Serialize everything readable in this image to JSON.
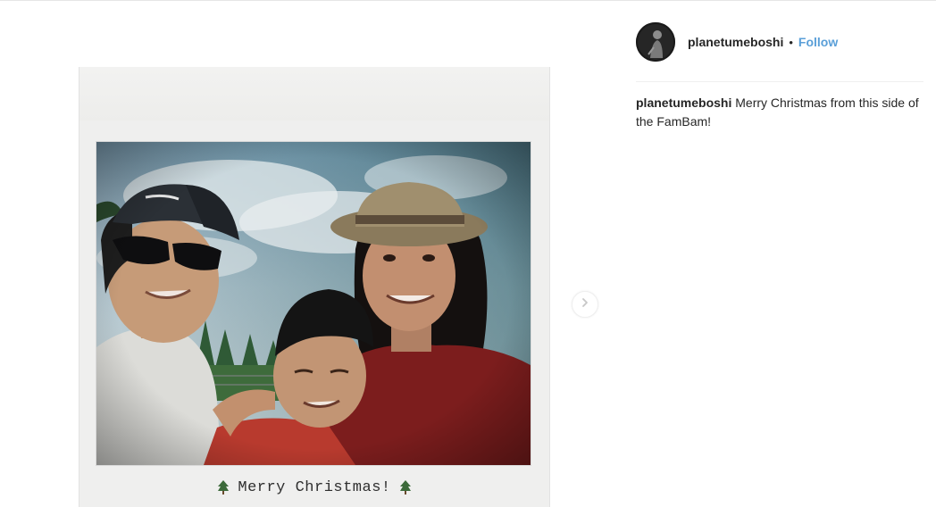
{
  "post": {
    "username": "planetumeboshi",
    "separator": "•",
    "follow_label": "Follow"
  },
  "caption": {
    "username": "planetumeboshi",
    "text": "Merry Christmas from this side of the FamBam!"
  },
  "media": {
    "card_text": "Merry Christmas!"
  },
  "icons": {
    "next": "chevron-right-icon",
    "tree_left": "christmas-tree-icon",
    "tree_right": "christmas-tree-icon"
  },
  "colors": {
    "follow": "#5a9fd8",
    "text": "#262626"
  }
}
